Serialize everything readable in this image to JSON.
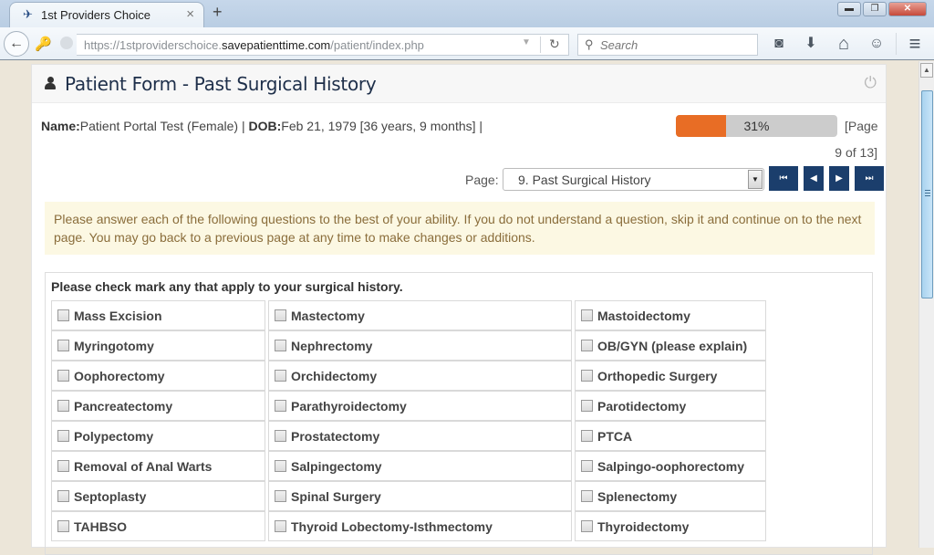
{
  "browser": {
    "tab_title": "1st Providers Choice",
    "tab_close": "×",
    "new_tab": "+",
    "url_prefix": "https://1stproviderschoice.",
    "url_domain": "savepatienttime.com",
    "url_path": "/patient/index.php",
    "search_placeholder": "Search",
    "window_buttons": {
      "minimize": "▬",
      "restore": "❐",
      "close": "✕"
    },
    "icons": {
      "back": "←",
      "key": "🔑",
      "dropdown": "▼",
      "reload": "↻",
      "search": "🔍",
      "pocket": "◙",
      "download": "⬇",
      "home": "⌂",
      "chat": "☺",
      "menu": "≡"
    }
  },
  "panel": {
    "title": "Patient Form - Past Surgical History",
    "power_icon": "⏻"
  },
  "patient": {
    "name_label": "Name:",
    "name_value": "Patient Portal Test (Female) | ",
    "dob_label": "DOB:",
    "dob_value": "Feb 21, 1979  [36 years, 9 months] |"
  },
  "progress": {
    "percent": 31,
    "label": "31%",
    "page_text_a": "[Page",
    "page_text_b": "9 of 13]"
  },
  "pager": {
    "label": "Page:",
    "selected": "9. Past Surgical History",
    "buttons": {
      "first": "⏮",
      "prev": "◀",
      "next": "▶",
      "last": "⏭"
    }
  },
  "notice": "Please answer each of the following questions to the best of your ability. If you do not understand a question, skip it and continue on to the next page. You may go back to a previous page at any time to make changes or additions.",
  "checklist": {
    "title": "Please check mark any that apply to your surgical history.",
    "items": [
      "Mass Excision",
      "Mastectomy",
      "Mastoidectomy",
      "Myringotomy",
      "Nephrectomy",
      "OB/GYN (please explain)",
      "Oophorectomy",
      "Orchidectomy",
      "Orthopedic Surgery",
      "Pancreatectomy",
      "Parathyroidectomy",
      "Parotidectomy",
      "Polypectomy",
      "Prostatectomy",
      "PTCA",
      "Removal of Anal Warts",
      "Salpingectomy",
      "Salpingo-oophorectomy",
      "Septoplasty",
      "Spinal Surgery",
      "Splenectomy",
      "TAHBSO",
      "Thyroid Lobectomy-Isthmectomy",
      "Thyroidectomy"
    ]
  },
  "colors": {
    "progress_fill": "#e86d25",
    "nav_button": "#1b3e6c",
    "notice_bg": "#fcf8e3",
    "notice_text": "#8a6d3b"
  }
}
